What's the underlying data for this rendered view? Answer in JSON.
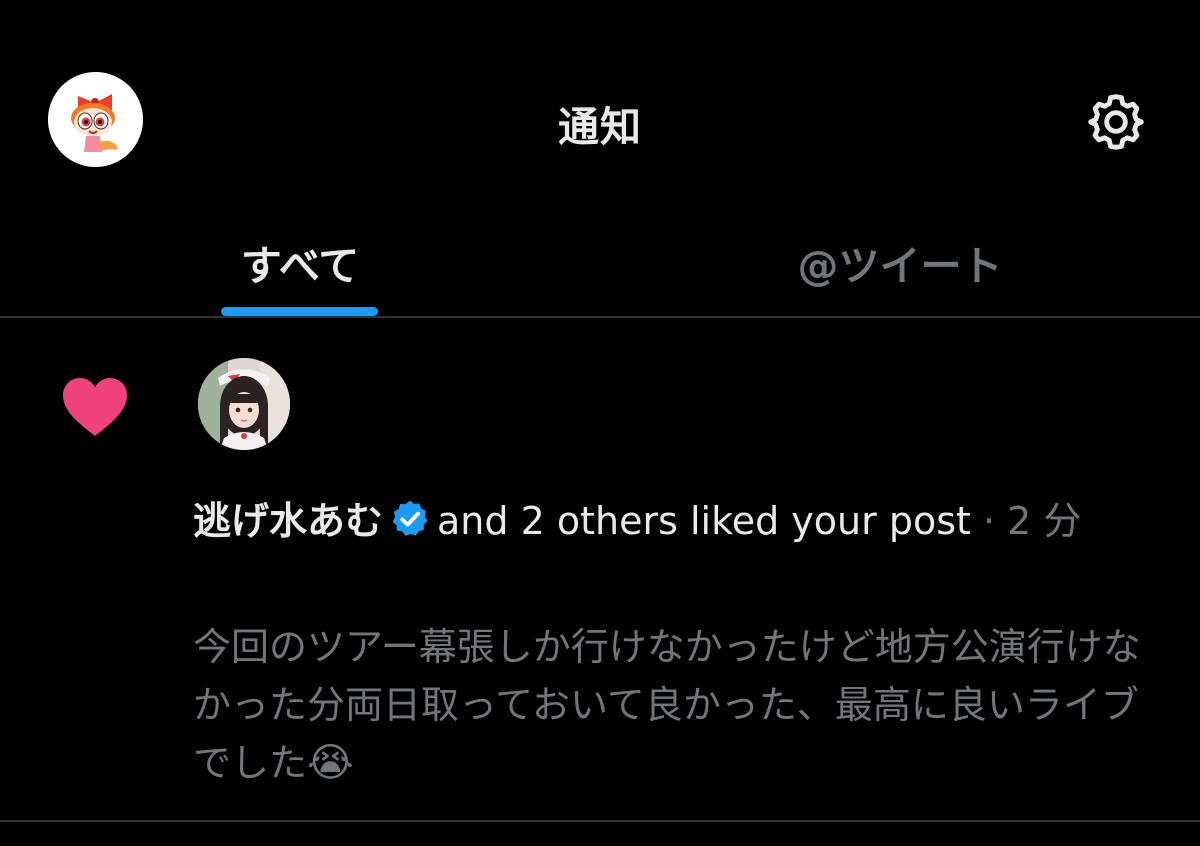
{
  "header": {
    "title": "通知",
    "avatar_icon": "blossom-avatar-icon",
    "settings_icon": "gear-icon"
  },
  "tabs": [
    {
      "label": "すべて",
      "active": true
    },
    {
      "label": "@ツイート",
      "active": false
    }
  ],
  "notification": {
    "type_icon": "heart-icon",
    "actor_name": "逃げ水あむ",
    "verified_icon": "verified-badge-icon",
    "action_text": "and 2 others liked your post",
    "separator": "·",
    "time": "2 分",
    "post_text": "今回のツアー幕張しか行けなかったけど地方公演行けなかった分両日取っておいて良かった、最高に良いライブでした",
    "post_emoji": "😭"
  },
  "colors": {
    "background": "#000000",
    "text_primary": "#e7e9ea",
    "text_secondary": "#71767b",
    "accent": "#1d9bf0",
    "heart": "#f0427d",
    "divider": "#2f3336"
  }
}
